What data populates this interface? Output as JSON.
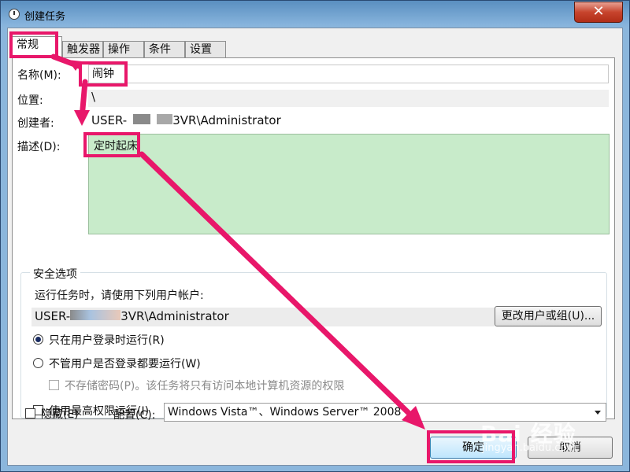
{
  "window": {
    "title": "创建任务",
    "close_glyph": "✕"
  },
  "tabs": [
    {
      "label": "常规",
      "active": true
    },
    {
      "label": "触发器",
      "active": false
    },
    {
      "label": "操作",
      "active": false
    },
    {
      "label": "条件",
      "active": false
    },
    {
      "label": "设置",
      "active": false
    }
  ],
  "general": {
    "name_label": "名称(M):",
    "name_value": "闹钟",
    "location_label": "位置:",
    "location_value": "\\",
    "author_label": "创建者:",
    "author_prefix": "USER-",
    "author_suffix": "3VR\\Administrator",
    "description_label": "描述(D):",
    "description_value": "定时起床"
  },
  "security": {
    "title": "安全选项",
    "run_as_label": "运行任务时，请使用下列用户帐户:",
    "user_prefix": "USER-",
    "user_suffix": "3VR\\Administrator",
    "change_user_button": "更改用户或组(U)...",
    "radio_logged_on": "只在用户登录时运行(R)",
    "radio_logged_on_checked": true,
    "radio_whether": "不管用户是否登录都要运行(W)",
    "radio_whether_checked": false,
    "no_store_password": "不存储密码(P)。该任务将只有访问本地计算机资源的权限",
    "highest_privileges": "使用最高权限运行(I)"
  },
  "footer": {
    "hidden_label": "隐藏(E)",
    "configure_label": "配置(C):",
    "configure_value": "Windows Vista™、Windows Server™ 2008",
    "ok_button": "确定",
    "cancel_button": "取消"
  },
  "watermark": {
    "text": "Bai 经验",
    "sub": "jingyan.baidu.com"
  },
  "colors": {
    "highlight": "#e8176a",
    "description_bg": "#c8ebca",
    "desktop_bg": "#1a1f8a"
  }
}
